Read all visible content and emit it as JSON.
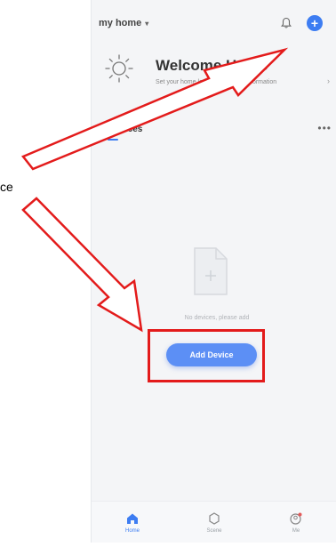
{
  "header": {
    "home_name": "my home",
    "chevron": "▾",
    "bell_icon": "bell-icon",
    "add_icon": "plus-circle-icon"
  },
  "welcome": {
    "title": "Welcome Home",
    "subtitle": "Set your home location for more information",
    "arrow": "›"
  },
  "devices": {
    "tab_label": "All Devices",
    "more": "•••"
  },
  "empty_state": {
    "text": "No devices, please add",
    "button_label": "Add Device"
  },
  "bottom_nav": {
    "items": [
      {
        "label": "Home",
        "icon": "home-icon",
        "active": true
      },
      {
        "label": "Scene",
        "icon": "scene-icon",
        "active": false
      },
      {
        "label": "Me",
        "icon": "profile-icon",
        "active": false
      }
    ]
  },
  "annotation": {
    "callout_text": "ce"
  },
  "colors": {
    "accent": "#3d7df2",
    "annotation_red": "#e31b1b",
    "background": "#f4f5f7"
  }
}
